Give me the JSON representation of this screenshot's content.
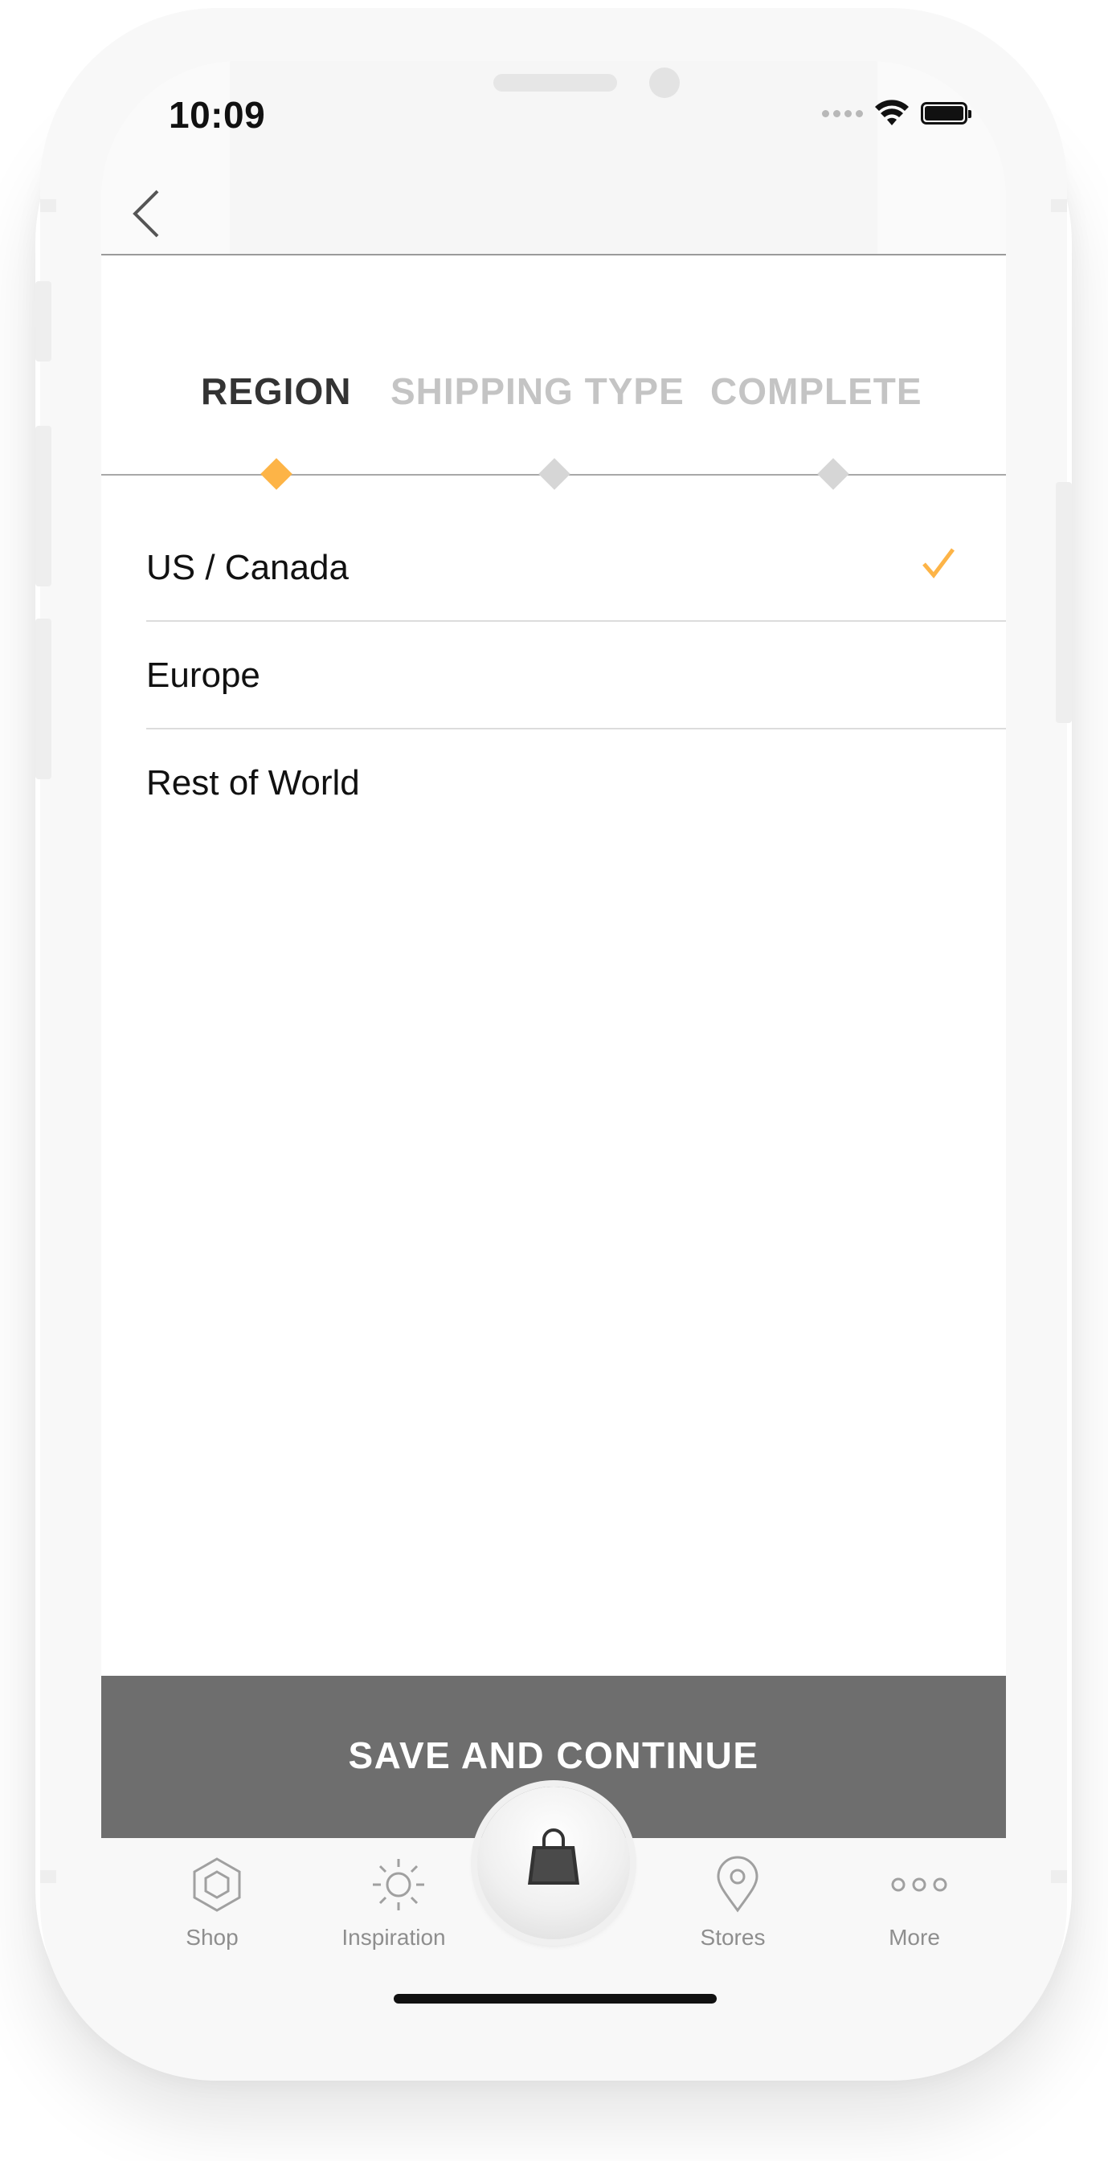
{
  "status_bar": {
    "time": "10:09",
    "icons": [
      "signal-icon",
      "wifi-icon",
      "battery-icon"
    ]
  },
  "nav": {
    "back_icon": "chevron-left-icon"
  },
  "steps": [
    {
      "label": "REGION",
      "state": "active"
    },
    {
      "label": "SHIPPING TYPE",
      "state": "inactive"
    },
    {
      "label": "COMPLETE",
      "state": "inactive"
    }
  ],
  "regions": [
    {
      "label": "US / Canada",
      "selected": true
    },
    {
      "label": "Europe",
      "selected": false
    },
    {
      "label": "Rest of World",
      "selected": false
    }
  ],
  "save_button": {
    "label": "SAVE AND CONTINUE"
  },
  "tabbar": {
    "tabs": [
      {
        "label": "Shop",
        "icon": "hexagon-icon"
      },
      {
        "label": "Inspiration",
        "icon": "sun-icon"
      },
      {
        "label": "Stores",
        "icon": "location-pin-icon"
      },
      {
        "label": "More",
        "icon": "more-dots-icon"
      }
    ],
    "center_icon": "shopping-bag-icon"
  },
  "colors": {
    "accent": "#FDB447",
    "step_active": "#333333",
    "step_inactive": "#C4C4C4",
    "button_bg": "#6E6E6E",
    "diamond_inactive": "#D6D6D6"
  }
}
